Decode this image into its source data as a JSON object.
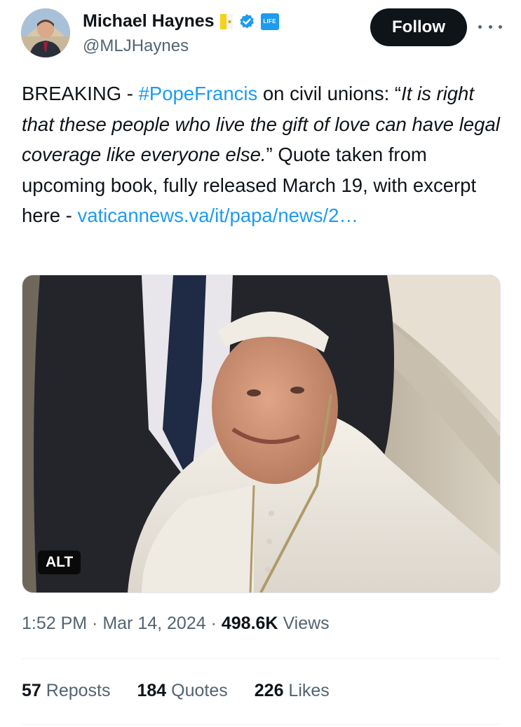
{
  "author": {
    "name": "Michael Haynes",
    "handle": "@MLJHaynes",
    "life_badge": "LIFE"
  },
  "header": {
    "follow_label": "Follow"
  },
  "tweet": {
    "breaking": "BREAKING - ",
    "hashtag": "#PopeFrancis",
    "text_1": " on civil unions: “",
    "quote": "It is right that these people who live the gift of love can have legal coverage like everyone else.",
    "text_2": "” Quote taken from upcoming book, fully released March 19, with excerpt here - ",
    "link": "vaticannews.va/it/papa/news/2…"
  },
  "media": {
    "alt_label": "ALT"
  },
  "meta": {
    "time": "1:52 PM",
    "sep1": " · ",
    "date": "Mar 14, 2024",
    "sep2": " · ",
    "views_count": "498.6K",
    "views_label": " Views"
  },
  "stats": {
    "reposts_count": "57",
    "reposts_label": " Reposts",
    "quotes_count": "184",
    "quotes_label": " Quotes",
    "likes_count": "226",
    "likes_label": " Likes"
  },
  "colors": {
    "link": "#1d9bf0",
    "text": "#0f1419",
    "secondary": "#536471",
    "follow_bg": "#0f1419"
  }
}
